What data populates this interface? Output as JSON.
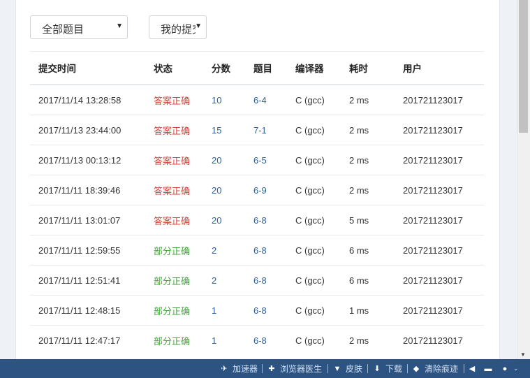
{
  "filters": {
    "problem_select": "全部题目",
    "user_select": "我的提交"
  },
  "table": {
    "headers": [
      "提交时间",
      "状态",
      "分数",
      "题目",
      "编译器",
      "耗时",
      "用户"
    ],
    "rows": [
      {
        "time": "2017/11/14 13:28:58",
        "status": "答案正确",
        "status_kind": "ok",
        "score": "10",
        "problem": "6-4",
        "compiler": "C (gcc)",
        "cost": "2 ms",
        "user": "201721123017"
      },
      {
        "time": "2017/11/13 23:44:00",
        "status": "答案正确",
        "status_kind": "ok",
        "score": "15",
        "problem": "7-1",
        "compiler": "C (gcc)",
        "cost": "2 ms",
        "user": "201721123017"
      },
      {
        "time": "2017/11/13 00:13:12",
        "status": "答案正确",
        "status_kind": "ok",
        "score": "20",
        "problem": "6-5",
        "compiler": "C (gcc)",
        "cost": "2 ms",
        "user": "201721123017"
      },
      {
        "time": "2017/11/11 18:39:46",
        "status": "答案正确",
        "status_kind": "ok",
        "score": "20",
        "problem": "6-9",
        "compiler": "C (gcc)",
        "cost": "2 ms",
        "user": "201721123017"
      },
      {
        "time": "2017/11/11 13:01:07",
        "status": "答案正确",
        "status_kind": "ok",
        "score": "20",
        "problem": "6-8",
        "compiler": "C (gcc)",
        "cost": "5 ms",
        "user": "201721123017"
      },
      {
        "time": "2017/11/11 12:59:55",
        "status": "部分正确",
        "status_kind": "part",
        "score": "2",
        "problem": "6-8",
        "compiler": "C (gcc)",
        "cost": "6 ms",
        "user": "201721123017"
      },
      {
        "time": "2017/11/11 12:51:41",
        "status": "部分正确",
        "status_kind": "part",
        "score": "2",
        "problem": "6-8",
        "compiler": "C (gcc)",
        "cost": "6 ms",
        "user": "201721123017"
      },
      {
        "time": "2017/11/11 12:48:15",
        "status": "部分正确",
        "status_kind": "part",
        "score": "1",
        "problem": "6-8",
        "compiler": "C (gcc)",
        "cost": "1 ms",
        "user": "201721123017"
      },
      {
        "time": "2017/11/11 12:47:17",
        "status": "部分正确",
        "status_kind": "part",
        "score": "1",
        "problem": "6-8",
        "compiler": "C (gcc)",
        "cost": "2 ms",
        "user": "201721123017"
      }
    ]
  },
  "statusbar": {
    "accelerator": "加速器",
    "doctor": "浏览器医生",
    "skin": "皮肤",
    "download": "下载",
    "clear": "清除痕迹"
  },
  "colors": {
    "ok": "#d0463b",
    "part": "#4aa245",
    "link": "#2e5f96",
    "statusbar_bg": "#2c5382"
  },
  "icons": [
    "chevron-down-icon",
    "rocket-icon",
    "medical-box-icon",
    "shirt-icon",
    "download-icon",
    "eraser-icon",
    "speaker-icon",
    "window-icon",
    "zoom-icon"
  ]
}
